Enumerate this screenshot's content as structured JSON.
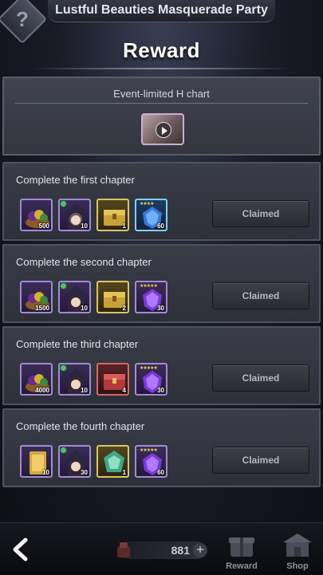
{
  "header": {
    "event_title": "Lustful Beauties Masquerade Party",
    "page_title": "Reward",
    "help_label": "?"
  },
  "limited": {
    "label": "Event-limited H chart",
    "video_icon": "play-icon"
  },
  "missions": [
    {
      "title": "Complete the first chapter",
      "status": "Claimed",
      "items": [
        {
          "icon": "fruit-basket-icon",
          "qty": "500"
        },
        {
          "icon": "character-card-icon",
          "qty": "10"
        },
        {
          "icon": "gold-chest-icon",
          "qty": "1"
        },
        {
          "icon": "blue-crystal-icon",
          "qty": "60"
        }
      ]
    },
    {
      "title": "Complete the second chapter",
      "status": "Claimed",
      "items": [
        {
          "icon": "fruit-basket-icon",
          "qty": "1500"
        },
        {
          "icon": "character-card-icon",
          "qty": "10"
        },
        {
          "icon": "gold-chest-icon",
          "qty": "2"
        },
        {
          "icon": "purple-crystal-icon",
          "qty": "30"
        }
      ]
    },
    {
      "title": "Complete the third chapter",
      "status": "Claimed",
      "items": [
        {
          "icon": "fruit-basket-icon",
          "qty": "4000"
        },
        {
          "icon": "character-card-icon",
          "qty": "10"
        },
        {
          "icon": "red-chest-icon",
          "qty": "4"
        },
        {
          "icon": "purple-crystal-icon",
          "qty": "30"
        }
      ]
    },
    {
      "title": "Complete the fourth chapter",
      "status": "Claimed",
      "items": [
        {
          "icon": "gold-ticket-icon",
          "qty": "10"
        },
        {
          "icon": "character-card-icon",
          "qty": "30"
        },
        {
          "icon": "emblem-icon",
          "qty": "1"
        },
        {
          "icon": "purple-crystal-icon",
          "qty": "60"
        }
      ]
    }
  ],
  "bottom": {
    "currency_value": "881",
    "reward_label": "Reward",
    "shop_label": "Shop"
  }
}
